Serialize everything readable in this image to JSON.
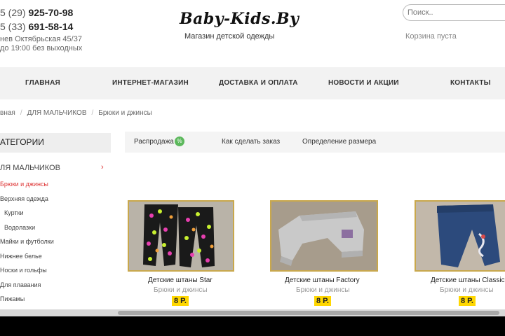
{
  "header": {
    "phone1_prefix": "5 (29)",
    "phone1_number": "925-70-98",
    "phone2_prefix": "5 (33)",
    "phone2_number": "691-58-14",
    "address": "нев Октябрьская 45/37",
    "hours": "до 19:00 без выходных",
    "logo": "Baby-Kids.By",
    "tagline": "Магазин детской одежды",
    "search_placeholder": "Поиск..",
    "cart": "Корзина пуста"
  },
  "nav": {
    "items": [
      {
        "label": "ГЛАВНАЯ"
      },
      {
        "label": "ИНТЕРНЕТ-МАГАЗИН"
      },
      {
        "label": "ДОСТАВКА И ОПЛАТА"
      },
      {
        "label": "НОВОСТИ И АКЦИИ"
      },
      {
        "label": "КОНТАКТЫ"
      }
    ]
  },
  "breadcrumb": {
    "items": [
      "вная",
      "ДЛЯ МАЛЬЧИКОВ",
      "Брюки и джинсы"
    ]
  },
  "sidebar": {
    "heading": "АТЕГОРИИ",
    "group": "ЛЯ МАЛЬЧИКОВ",
    "group_chevron": "›",
    "items": [
      {
        "label": "Брюки и джинсы"
      },
      {
        "label": "Верхняя одежда"
      },
      {
        "label": "Куртки"
      },
      {
        "label": "Водолазки"
      },
      {
        "label": "Майки и футболки"
      },
      {
        "label": "Нижнее белье"
      },
      {
        "label": "Носки и гольфы"
      },
      {
        "label": "Для плавания"
      },
      {
        "label": "Пижамы"
      }
    ]
  },
  "tabs": {
    "sale": "Распродажа",
    "how_to_order": "Как сделать заказ",
    "size_guide": "Определение размера"
  },
  "products": [
    {
      "title": "Детские штаны Star",
      "category": "Брюки и джинсы",
      "price": "8 Р."
    },
    {
      "title": "Детские штаны Factory",
      "category": "Брюки и джинсы",
      "price": "8 Р."
    },
    {
      "title": "Детские штаны Classic",
      "category": "Брюки и джинсы",
      "price": "8 Р."
    }
  ],
  "colors": {
    "accent_red": "#dd3333",
    "price_yellow": "#ffd700",
    "image_border": "#c9a84c",
    "sale_green": "#5cb85c"
  }
}
